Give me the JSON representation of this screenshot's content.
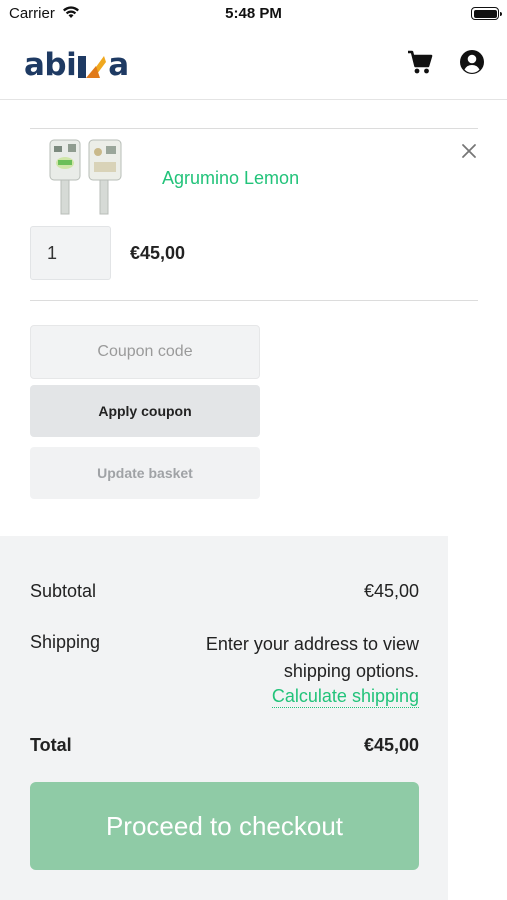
{
  "status_bar": {
    "carrier": "Carrier",
    "time": "5:48 PM"
  },
  "header": {
    "logo_text_left": "abi",
    "logo_text_right": "a",
    "icons": [
      "cart-icon",
      "account-icon"
    ]
  },
  "cart": {
    "item": {
      "name": "Agrumino Lemon",
      "quantity": "1",
      "price": "€45,00"
    }
  },
  "coupon": {
    "placeholder": "Coupon code",
    "apply_label": "Apply coupon",
    "update_label": "Update basket"
  },
  "totals": {
    "subtotal_label": "Subtotal",
    "subtotal_value": "€45,00",
    "shipping_label": "Shipping",
    "shipping_text": "Enter your address to view shipping options.",
    "calculate_shipping": "Calculate shipping",
    "total_label": "Total",
    "total_value": "€45,00"
  },
  "checkout": {
    "label": "Proceed to checkout"
  },
  "colors": {
    "brand_navy": "#1e3a63",
    "accent_green": "#22c37a",
    "checkout_green": "#8fcba6",
    "logo_gold": "#f0a81e"
  }
}
